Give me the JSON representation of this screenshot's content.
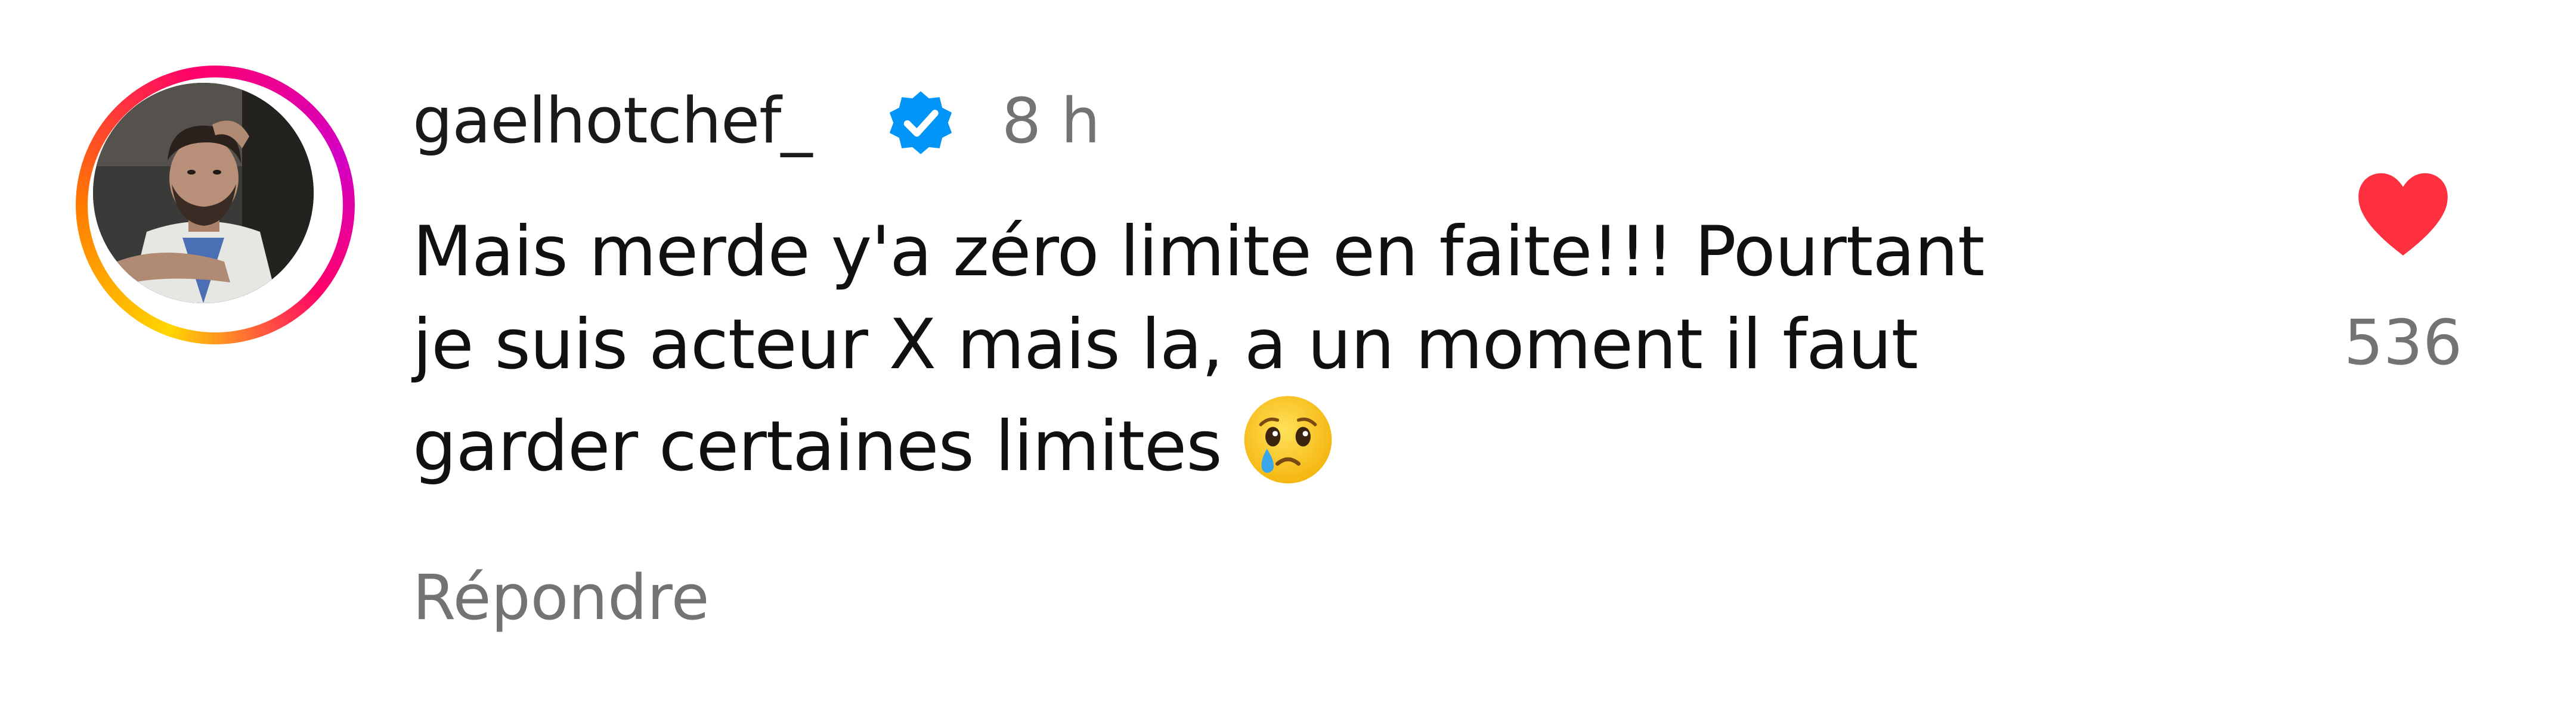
{
  "comment": {
    "author": {
      "username": "gaelhotchef_",
      "verified": true,
      "avatar_icon": "profile-photo",
      "story_ring": true
    },
    "time_ago": "8 h",
    "text_lines": [
      "Mais merde y'a zéro limite en faite!!! Pourtant",
      "je suis acteur X mais la, a un moment il faut",
      "garder certaines limites"
    ],
    "emoji": "crying-face",
    "reply_label": "Répondre",
    "likes": {
      "count": "536",
      "liked": true,
      "icon": "heart-icon"
    }
  },
  "colors": {
    "text": "#101010",
    "secondary": "#737373",
    "verified": "#0095f6",
    "heart": "#ff3040"
  }
}
